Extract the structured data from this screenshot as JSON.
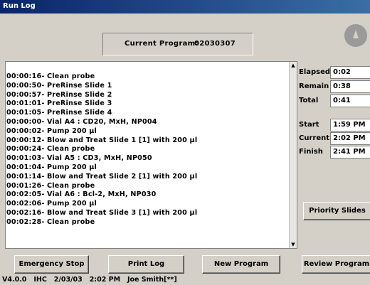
{
  "window": {
    "title": "Run Log"
  },
  "program": {
    "label": "Current Program:",
    "value": "02030307"
  },
  "log_lines": [
    "00:00:16- Clean probe",
    "00:00:50- PreRinse Slide 1",
    "00:00:57- PreRinse Slide 2",
    "00:01:01- PreRinse Slide 3",
    "00:01:05- PreRinse Slide 4",
    "00:00:00- Vial A4 : CD20, MxH, NP004",
    "00:00:02- Pump 200 µl",
    "00:00:12- Blow and Treat Slide 1 [1] with 200 µl",
    "00:00:24- Clean probe",
    "00:01:03- Vial A5 : CD3, MxH, NP050",
    "00:01:04- Pump 200 µl",
    "00:01:14- Blow and Treat Slide 2 [1] with 200 µl",
    "00:01:26- Clean probe",
    "00:02:05- Vial A6 : Bcl-2, MxH, NP030",
    "00:02:06- Pump 200 µl",
    "00:02:16- Blow and Treat Slide 3 [1] with 200 µl",
    "00:02:28- Clean probe"
  ],
  "timers": {
    "elapsed_label": "Elapsed",
    "elapsed_value": "0:02",
    "remain_label": "Remain",
    "remain_value": "0:38",
    "total_label": "Total",
    "total_value": "0:41"
  },
  "clock": {
    "start_label": "Start",
    "start_value": "1:59 PM",
    "current_label": "Current",
    "current_value": "2:02 PM",
    "finish_label": "Finish",
    "finish_value": "2:41 PM"
  },
  "buttons": {
    "priority": "Priority Slides",
    "emergency": "Emergency Stop",
    "print": "Print Log",
    "new_program": "New Program",
    "review": "Review Program"
  },
  "status_bar": {
    "version": "V4.0.0",
    "org": "IHC",
    "date": "2/03/03",
    "time": "2:02 PM",
    "user": "Joe Smith[**]"
  },
  "colors": {
    "titlebar": "#0a246a",
    "window_bg": "#d4d0c8",
    "logo": "#9a9a9a"
  }
}
